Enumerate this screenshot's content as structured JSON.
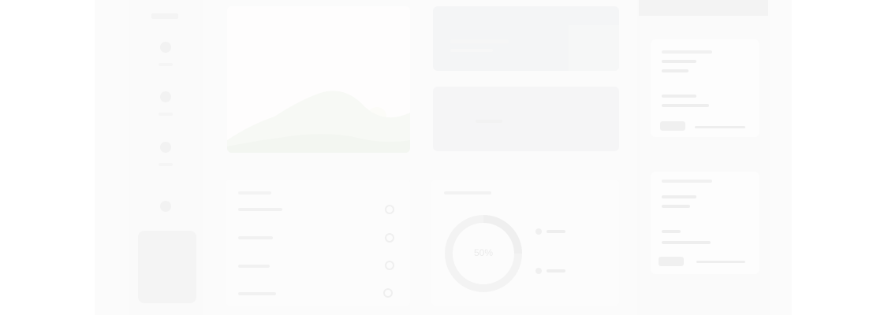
{
  "donut": {
    "center_label": "50%"
  },
  "colors": {
    "background": "#ffffff",
    "frame": "#fbfbfb",
    "card": "#fcfcfc",
    "faint": "#f0f0f0"
  },
  "icons": {
    "sidebar": [
      "home-icon",
      "grid-icon",
      "chart-icon",
      "settings-icon"
    ],
    "list_checks": [
      "check-circle-icon",
      "check-circle-icon",
      "check-circle-icon",
      "check-circle-icon"
    ]
  }
}
